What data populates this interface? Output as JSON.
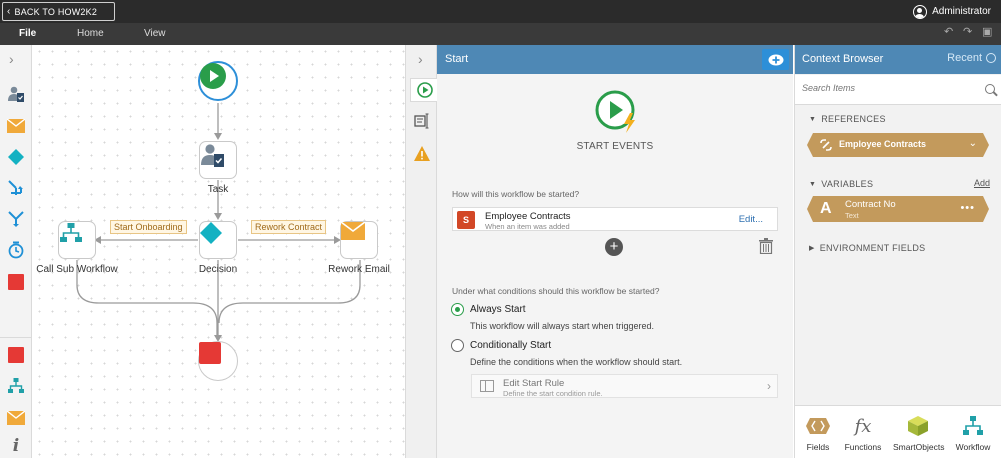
{
  "topbar": {
    "back_label": "BACK TO HOW2K2",
    "user": "Administrator"
  },
  "menu": {
    "file": "File",
    "home": "Home",
    "view": "View"
  },
  "canvas": {
    "task_label": "Task",
    "decision_label": "Decision",
    "sub_workflow_label": "Call Sub Workflow",
    "rework_email_label": "Rework Email",
    "line_start_onboarding": "Start Onboarding",
    "line_rework_contract": "Rework Contract"
  },
  "panel": {
    "title": "Start",
    "start_events_label": "START EVENTS",
    "question_started": "How will this workflow be started?",
    "event": {
      "name": "Employee Contracts",
      "subtitle": "When an item was added",
      "edit": "Edit..."
    },
    "question_conditions": "Under what conditions should this workflow be started?",
    "options": [
      {
        "label": "Always Start",
        "desc": "This workflow will always start when triggered.",
        "selected": true
      },
      {
        "label": "Conditionally Start",
        "desc": "Define the conditions when the workflow should start.",
        "selected": false
      }
    ],
    "rule": {
      "name": "Edit Start Rule",
      "subtitle": "Define the start condition rule."
    }
  },
  "context": {
    "title": "Context Browser",
    "recent": "Recent",
    "search_placeholder": "Search Items",
    "references_label": "REFERENCES",
    "reference_item": "Employee Contracts",
    "variables_label": "VARIABLES",
    "add_label": "Add",
    "variable": {
      "letter": "A",
      "name": "Contract No",
      "type": "Text"
    },
    "environment_label": "ENVIRONMENT FIELDS",
    "footer": [
      "Fields",
      "Functions",
      "SmartObjects",
      "Workflow"
    ]
  },
  "colors": {
    "accent_blue": "#4e88b5",
    "pill_tan": "#c39a5c",
    "start_green": "#2a9d4a",
    "stop_red": "#e53935",
    "decision_teal": "#13b1c2",
    "mail_orange": "#f0a93a"
  }
}
